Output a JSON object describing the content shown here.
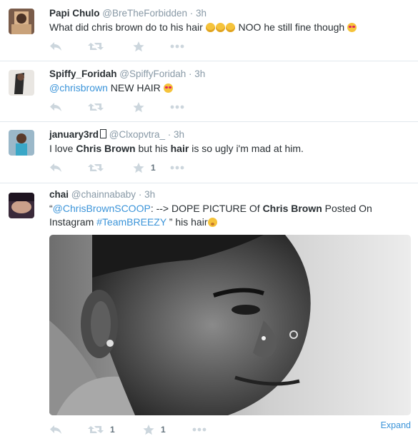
{
  "tweets": [
    {
      "name": "Papi Chulo",
      "handle": "@BreTheForbidden",
      "time": "· 3h",
      "text": [
        {
          "t": "What did chris brown do to his hair ",
          "style": "plain"
        },
        {
          "t": "",
          "style": "emoji",
          "emoji": "tired-face"
        },
        {
          "t": "",
          "style": "emoji",
          "emoji": "tired-face"
        },
        {
          "t": "",
          "style": "emoji",
          "emoji": "tired-face"
        },
        {
          "t": " NOO he still fine though ",
          "style": "plain"
        },
        {
          "t": "",
          "style": "emoji",
          "emoji": "heart-eyes"
        }
      ],
      "retweets": "",
      "favorites": ""
    },
    {
      "name": "Spiffy_Foridah",
      "handle": "@SpiffyForidah",
      "time": "· 3h",
      "text": [
        {
          "t": "@chrisbrown",
          "style": "link"
        },
        {
          "t": " NEW HAIR ",
          "style": "plain"
        },
        {
          "t": "",
          "style": "emoji",
          "emoji": "heart-eyes"
        }
      ],
      "retweets": "",
      "favorites": ""
    },
    {
      "name": "january3rd",
      "handle": "@Clxopvtra_",
      "time": "· 3h",
      "text": [
        {
          "t": "I love ",
          "style": "plain"
        },
        {
          "t": "Chris Brown",
          "style": "bold"
        },
        {
          "t": " but his ",
          "style": "plain"
        },
        {
          "t": "hair",
          "style": "bold"
        },
        {
          "t": " is so ugly i'm mad at him.",
          "style": "plain"
        }
      ],
      "retweets": "",
      "favorites": "1"
    },
    {
      "name": "chai",
      "handle": "@chainnababy",
      "time": "· 3h",
      "text": [
        {
          "t": "“",
          "style": "plain"
        },
        {
          "t": "@ChrisBrownSCOOP",
          "style": "link"
        },
        {
          "t": ": --> DOPE PICTURE Of ",
          "style": "plain"
        },
        {
          "t": "Chris Brown",
          "style": "bold"
        },
        {
          "t": " Posted On Instagram ",
          "style": "plain"
        },
        {
          "t": "#TeamBREEZY",
          "style": "link"
        },
        {
          "t": " ” his hair",
          "style": "plain"
        },
        {
          "t": "",
          "style": "emoji",
          "emoji": "flushed-face"
        }
      ],
      "retweets": "1",
      "favorites": "1",
      "expand_label": "Expand"
    }
  ],
  "colors": {
    "link": "#3b94d9",
    "action_icon": "#ccd6dd",
    "meta": "#8899a6"
  },
  "icons": [
    "reply-icon",
    "retweet-icon",
    "favorite-icon",
    "more-icon"
  ]
}
